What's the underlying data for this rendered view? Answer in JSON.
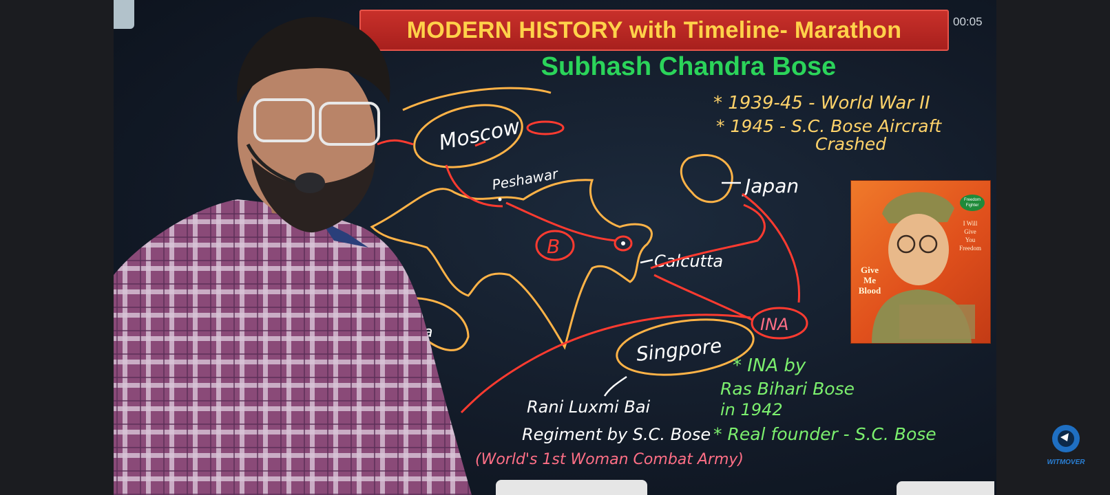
{
  "header": {
    "title": "MODERN HISTORY with Timeline- Marathon",
    "subtitle": "Subhash Chandra Bose",
    "timer": "00:05"
  },
  "board": {
    "notes_top": [
      "* 1939-45 - World War II",
      "* 1945 - S.C. Bose Aircraft",
      "Crashed"
    ],
    "map_labels": {
      "moscow": "Moscow",
      "peshawar": "Peshawar",
      "b": "B",
      "calcutta": "Calcutta",
      "japan": "Japan",
      "ina": "INA",
      "singapore": "Singpore",
      "fragment": "a"
    },
    "notes_green": [
      "* INA by",
      "Ras Bihari Bose",
      "in 1942",
      "* Real founder - S.C. Bose"
    ],
    "notes_bottom": [
      "Rani Luxmi Bai",
      "Regiment by S.C. Bose",
      "(World's 1st Woman Combat Army)"
    ]
  },
  "poster": {
    "badge": "Freedom Fighter",
    "quote_left": [
      "Give",
      "Me",
      "Blood"
    ],
    "quote_right": [
      "I Will",
      "Give",
      "You",
      "Freedom"
    ]
  },
  "logo": {
    "text": "WITMOVER"
  },
  "colors": {
    "banner": "#c8302a",
    "banner_text": "#ffd24a",
    "subtitle": "#2bd45a",
    "ink_red": "#ff3b30",
    "ink_orange": "#ffb347",
    "ink_white": "#ffffff",
    "ink_yellow": "#ffd36a",
    "ink_green": "#7cf06e",
    "ink_pink": "#ff6f86"
  }
}
